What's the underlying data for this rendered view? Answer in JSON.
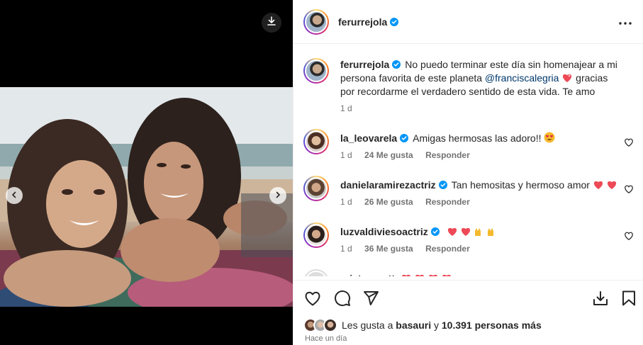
{
  "post": {
    "author": "ferurrejola",
    "caption_pre": "No puedo terminar este día sin homenajear a mi persona favorita de este planeta ",
    "caption_mention": "@franciscalegria",
    "caption_post": " gracias por recordarme el verdadero sentido de esta vida. Te amo",
    "caption_time": "1 d"
  },
  "comments": [
    {
      "user": "la_leovarela",
      "text": "Amigas hermosas las adoro!!",
      "emoji": "heart-eyes",
      "time": "1 d",
      "likes": "24 Me gusta",
      "reply": "Responder"
    },
    {
      "user": "danielaramirezactriz",
      "text": "Tan hemositas y hermoso amor",
      "emoji": "two-hearts",
      "time": "1 d",
      "likes": "26 Me gusta",
      "reply": "Responder"
    },
    {
      "user": "luzvaldiviesoactriz",
      "text": "",
      "emoji": "hearts-and-hands",
      "time": "1 d",
      "likes": "36 Me gusta",
      "reply": "Responder"
    },
    {
      "user": "cristomontt",
      "text": "",
      "emoji": "four-hearts"
    }
  ],
  "likes": {
    "prefix": "Les gusta a ",
    "user": "basauri",
    "mid": " y ",
    "count": "10.391 personas más"
  },
  "timestamp": "Hace un día",
  "colors": {
    "verified": "#0095f6",
    "heart": "#ed4956",
    "mention": "#00376b",
    "muted": "#737373"
  }
}
